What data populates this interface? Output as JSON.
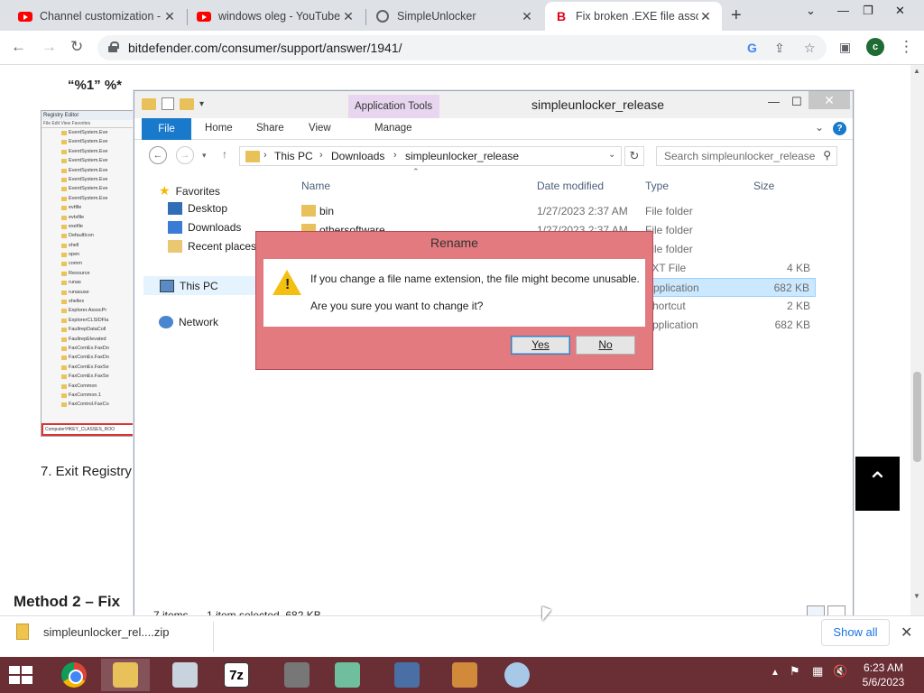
{
  "browser": {
    "tabs": [
      {
        "title": "Channel customization -",
        "icon": "youtube-icon"
      },
      {
        "title": "windows oleg - YouTube",
        "icon": "youtube-icon"
      },
      {
        "title": "SimpleUnlocker",
        "icon": "globe-icon"
      },
      {
        "title": "Fix broken .EXE file assoc",
        "icon": "bitdefender-icon",
        "active": true
      }
    ],
    "url": "bitdefender.com/consumer/support/answer/1941/",
    "profile_initial": "c"
  },
  "page": {
    "quote_text": "“%1” %*",
    "step7": "7. Exit Registry",
    "method2": "Method 2 – Fix",
    "registry_title": "Registry Editor",
    "registry_menu": "File  Edit  View  Favorites",
    "registry_rows": [
      "EventSystem.Eve",
      "EventSystem.Eve",
      "EventSystem.Eve",
      "EventSystem.Eve",
      "EventSystem.Eve",
      "EventSystem.Eve",
      "EventSystem.Eve",
      "EventSystem.Eve",
      "evtfile",
      "evtxfile",
      "exefile",
      "DefaultIcon",
      "shell",
      "open",
      "comm",
      "Resource",
      "runas",
      "runasuse",
      "shellex",
      "Explorer.AssocPr",
      "ExplorerCLSIDFla",
      "FaultrepDataColl",
      "FaultrepElevated",
      "FaxComEx.FaxDo",
      "FaxComEx.FaxDo",
      "FaxComEx.FaxSe",
      "FaxComEx.FaxSe",
      "FaxCommon",
      "FaxCommon.1",
      "FaxControl.FaxCo"
    ],
    "registry_status": "Computer\\HKEY_CLASSES_ROO"
  },
  "explorer": {
    "title": "simpleunlocker_release",
    "app_tools": "Application Tools",
    "ribbon_tabs": {
      "file": "File",
      "home": "Home",
      "share": "Share",
      "view": "View",
      "manage": "Manage"
    },
    "breadcrumb": [
      "This PC",
      "Downloads",
      "simpleunlocker_release"
    ],
    "search_placeholder": "Search simpleunlocker_release",
    "nav": {
      "favorites": "Favorites",
      "desktop": "Desktop",
      "downloads": "Downloads",
      "recent": "Recent places",
      "thispc": "This PC",
      "network": "Network"
    },
    "columns": {
      "name": "Name",
      "date": "Date modified",
      "type": "Type",
      "size": "Size"
    },
    "files": [
      {
        "name": "bin",
        "date": "1/27/2023 2:37 AM",
        "type": "File folder",
        "size": ""
      },
      {
        "name": "othersoftware",
        "date": "1/27/2023 2:37 AM",
        "type": "File folder",
        "size": ""
      },
      {
        "name": "",
        "date": "",
        "type": "File folder",
        "size": ""
      },
      {
        "name": "",
        "date": "",
        "type": "TXT File",
        "size": "4 KB"
      },
      {
        "name": "",
        "date": "",
        "type": "Application",
        "size": "682 KB",
        "selected": true
      },
      {
        "name": "",
        "date": "",
        "type": "Shortcut",
        "size": "2 KB"
      },
      {
        "name": "",
        "date": "",
        "type": "Application",
        "size": "682 KB"
      }
    ],
    "status_items": "7 items",
    "status_selected": "1 item selected  682 KB"
  },
  "dialog": {
    "title": "Rename",
    "line1": "If you change a file name extension, the file might become unusable.",
    "line2": "Are you sure you want to change it?",
    "yes": "Yes",
    "no": "No"
  },
  "downloads": {
    "file": "simpleunlocker_rel....zip",
    "show_all": "Show all"
  },
  "taskbar": {
    "time": "6:23 AM",
    "date": "5/6/2023",
    "sevenzip": "7z"
  },
  "colors": {
    "taskbar": "#6a2e35",
    "dialog_frame": "#e27a80",
    "accent": "#1979ca"
  }
}
